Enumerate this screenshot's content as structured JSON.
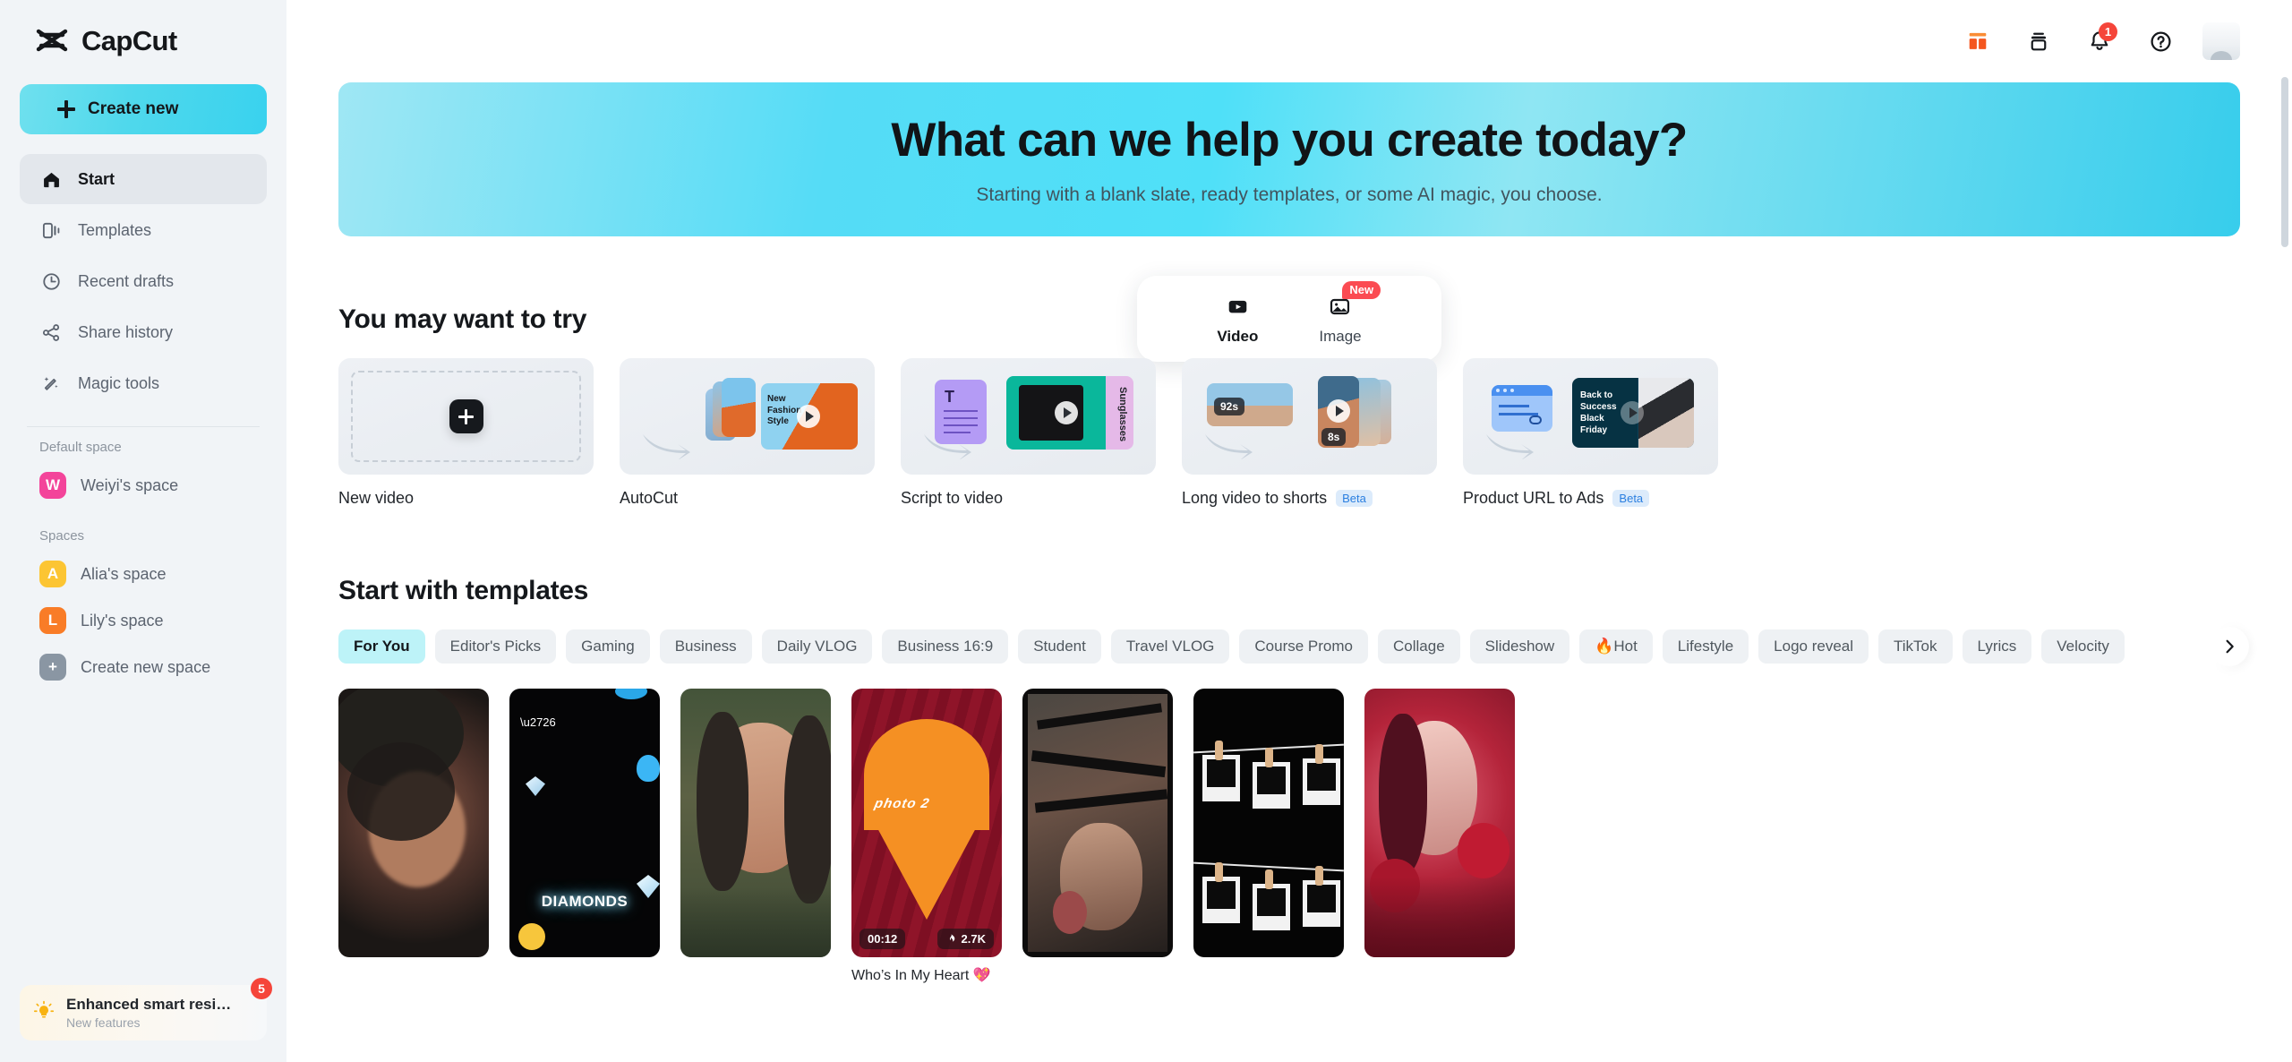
{
  "brand": {
    "name": "CapCut",
    "logo_icon": "capcut-logo-icon"
  },
  "sidebar": {
    "create_new_label": "Create new",
    "nav_items": [
      {
        "label": "Start",
        "icon": "home-icon",
        "active": true
      },
      {
        "label": "Templates",
        "icon": "templates-icon",
        "active": false
      },
      {
        "label": "Recent drafts",
        "icon": "clock-icon",
        "active": false
      },
      {
        "label": "Share history",
        "icon": "share-icon",
        "active": false
      },
      {
        "label": "Magic tools",
        "icon": "magic-wand-icon",
        "active": false
      }
    ],
    "default_space_label": "Default space",
    "default_space": {
      "label": "Weiyi's space",
      "initial": "W",
      "color": "#f3449a"
    },
    "spaces_label": "Spaces",
    "spaces": [
      {
        "label": "Alia's space",
        "initial": "A",
        "color": "#fcc533"
      },
      {
        "label": "Lily's space",
        "initial": "L",
        "color": "#f97c27"
      },
      {
        "label": "Create new space",
        "initial": "+",
        "color": "#8a96a3"
      }
    ],
    "promo": {
      "title": "Enhanced smart resi…",
      "subtitle": "New features",
      "badge_count": "5",
      "icon": "lightbulb-icon"
    }
  },
  "topbar": {
    "icons": [
      {
        "name": "dashboard-grid-icon",
        "color": "#f76b1c"
      },
      {
        "name": "archive-box-icon",
        "color": "#15181c"
      },
      {
        "name": "bell-icon",
        "color": "#15181c",
        "badge": "1"
      },
      {
        "name": "help-circle-icon",
        "color": "#15181c"
      }
    ],
    "avatar_name": "user-avatar"
  },
  "hero": {
    "title": "What can we help you create today?",
    "subtitle": "Starting with a blank slate, ready templates, or some AI magic, you choose.",
    "gradient_from": "#9fe7f4",
    "gradient_to": "#37cdec"
  },
  "mode_tabs": [
    {
      "label": "Video",
      "icon": "video-icon",
      "active": true,
      "badge": ""
    },
    {
      "label": "Image",
      "icon": "image-icon",
      "active": false,
      "badge": "New"
    }
  ],
  "try_section": {
    "title": "You may want to try",
    "cards": [
      {
        "label": "New video",
        "badge": "",
        "kind": "new-video"
      },
      {
        "label": "AutoCut",
        "badge": "",
        "kind": "autocut",
        "overlay_text": "New\nFashion\nStyle"
      },
      {
        "label": "Script to video",
        "badge": "",
        "kind": "script-to-video",
        "overlay_text": "Sunglasses"
      },
      {
        "label": "Long video to shorts",
        "badge": "Beta",
        "kind": "long-to-shorts",
        "tag_a": "92s",
        "tag_b": "8s"
      },
      {
        "label": "Product URL to Ads",
        "badge": "Beta",
        "kind": "url-to-ads",
        "overlay_text": "Back to Success Black Friday"
      }
    ]
  },
  "templates_section": {
    "title": "Start with templates",
    "categories": [
      {
        "label": "For You",
        "active": true
      },
      {
        "label": "Editor's Picks",
        "active": false
      },
      {
        "label": "Gaming",
        "active": false
      },
      {
        "label": "Business",
        "active": false
      },
      {
        "label": "Daily VLOG",
        "active": false
      },
      {
        "label": "Business 16:9",
        "active": false
      },
      {
        "label": "Student",
        "active": false
      },
      {
        "label": "Travel VLOG",
        "active": false
      },
      {
        "label": "Course Promo",
        "active": false
      },
      {
        "label": "Collage",
        "active": false
      },
      {
        "label": "Slideshow",
        "active": false
      },
      {
        "label": "🔥Hot",
        "active": false
      },
      {
        "label": "Lifestyle",
        "active": false
      },
      {
        "label": "Logo reveal",
        "active": false
      },
      {
        "label": "TikTok",
        "active": false
      },
      {
        "label": "Lyrics",
        "active": false
      },
      {
        "label": "Velocity",
        "active": false
      }
    ],
    "next_arrow_icon": "chevron-right-icon",
    "items": [
      {
        "title": "",
        "duration": "",
        "uses": "",
        "kind": "portrait-dark"
      },
      {
        "title": "",
        "duration": "",
        "uses": "",
        "kind": "diamonds",
        "overlay_text": "DIAMONDS"
      },
      {
        "title": "",
        "duration": "",
        "uses": "",
        "kind": "portrait-green"
      },
      {
        "title": "Who’s In My Heart 💖",
        "duration": "00:12",
        "uses": "2.7K",
        "kind": "heart",
        "overlay_text": "photo 2"
      },
      {
        "title": "",
        "duration": "",
        "uses": "",
        "kind": "frames"
      },
      {
        "title": "",
        "duration": "",
        "uses": "",
        "kind": "polaroids"
      },
      {
        "title": "",
        "duration": "",
        "uses": "",
        "kind": "roses"
      }
    ]
  }
}
